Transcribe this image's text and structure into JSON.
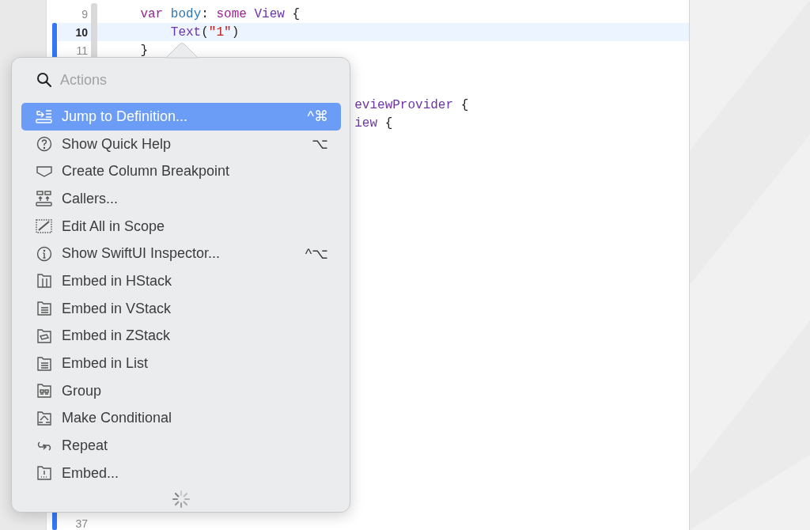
{
  "editor": {
    "lines": [
      {
        "number": "9",
        "current": false,
        "tokens": [
          {
            "text": "    var",
            "kind": "keyword"
          },
          {
            "text": " body",
            "kind": "decl"
          },
          {
            "text": ": ",
            "kind": "plain"
          },
          {
            "text": "some",
            "kind": "keyword"
          },
          {
            "text": " View",
            "kind": "type"
          },
          {
            "text": " {",
            "kind": "plain"
          }
        ]
      },
      {
        "number": "10",
        "current": true,
        "tokens": [
          {
            "text": "        Text",
            "kind": "type"
          },
          {
            "text": "(",
            "kind": "plain"
          },
          {
            "text": "\"1\"",
            "kind": "string"
          },
          {
            "text": ")",
            "kind": "plain"
          }
        ]
      },
      {
        "number": "11",
        "current": false,
        "tokens": [
          {
            "text": "    }",
            "kind": "plain"
          }
        ]
      }
    ],
    "partial_lines": [
      {
        "tokens": [
          {
            "text": "eviewProvider",
            "kind": "type"
          },
          {
            "text": " {",
            "kind": "plain"
          }
        ]
      },
      {
        "tokens": [
          {
            "text": "iew",
            "kind": "type"
          },
          {
            "text": " {",
            "kind": "plain"
          }
        ]
      }
    ],
    "bottom_line": {
      "number": "37"
    }
  },
  "actions_menu": {
    "search": {
      "placeholder": "Actions"
    },
    "items": [
      {
        "label": "Jump to Definition...",
        "shortcut": "^⌘",
        "selected": true
      },
      {
        "label": "Show Quick Help",
        "shortcut": "⌥",
        "selected": false
      },
      {
        "label": "Create Column Breakpoint",
        "selected": false
      },
      {
        "label": "Callers...",
        "selected": false
      },
      {
        "label": "Edit All in Scope",
        "selected": false
      },
      {
        "label": "Show SwiftUI Inspector...",
        "shortcut": "^⌥",
        "selected": false
      },
      {
        "label": "Embed in HStack",
        "selected": false
      },
      {
        "label": "Embed in VStack",
        "selected": false
      },
      {
        "label": "Embed in ZStack",
        "selected": false
      },
      {
        "label": "Embed in List",
        "selected": false
      },
      {
        "label": "Group",
        "selected": false
      },
      {
        "label": "Make Conditional",
        "selected": false
      },
      {
        "label": "Repeat",
        "selected": false
      },
      {
        "label": "Embed...",
        "selected": false
      }
    ],
    "loading": true
  }
}
